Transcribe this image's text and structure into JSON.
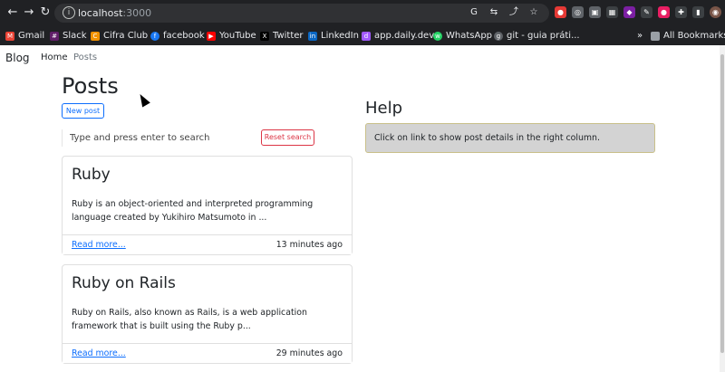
{
  "browser": {
    "url_host": "localhost",
    "url_port": ":3000",
    "bookmarks": [
      {
        "label": "Gmail",
        "icon": "gmail-icon",
        "color": "#ea4335",
        "glyph": "M"
      },
      {
        "label": "Slack",
        "icon": "slack-icon",
        "color": "#611f69",
        "glyph": "#"
      },
      {
        "label": "Cifra Club",
        "icon": "cifra-club-icon",
        "color": "#f29200",
        "glyph": "C"
      },
      {
        "label": "facebook",
        "icon": "facebook-icon",
        "color": "#1877f2",
        "glyph": "f"
      },
      {
        "label": "YouTube",
        "icon": "youtube-icon",
        "color": "#ff0000",
        "glyph": "▶"
      },
      {
        "label": "Twitter",
        "icon": "x-icon",
        "color": "#000000",
        "glyph": "X"
      },
      {
        "label": "LinkedIn",
        "icon": "linkedin-icon",
        "color": "#0a66c2",
        "glyph": "in"
      },
      {
        "label": "app.daily.dev",
        "icon": "daily-dev-icon",
        "color": "#a259ff",
        "glyph": "d"
      },
      {
        "label": "WhatsApp",
        "icon": "whatsapp-icon",
        "color": "#25d366",
        "glyph": "w"
      },
      {
        "label": "git - guia práti...",
        "icon": "globe-icon",
        "color": "#5f6368",
        "glyph": "g"
      }
    ],
    "more_label": "»",
    "all_bookmarks": "All Bookmarks"
  },
  "navbar": {
    "brand": "Blog",
    "home": "Home",
    "posts": "Posts"
  },
  "main": {
    "title": "Posts",
    "new_post_label": "New post",
    "search_placeholder": "Type and press enter to search",
    "reset_label": "Reset search",
    "posts": [
      {
        "title": "Ruby",
        "excerpt": "Ruby is an object-oriented and interpreted programming language created by Yukihiro Matsumoto in ...",
        "read_more": "Read more...",
        "time": "13 minutes ago"
      },
      {
        "title": "Ruby on Rails",
        "excerpt": "Ruby on Rails, also known as Rails, is a web application framework that is built using the Ruby p...",
        "read_more": "Read more...",
        "time": "29 minutes ago"
      }
    ]
  },
  "help": {
    "title": "Help",
    "message": "Click on link to show post details in the right column."
  },
  "colors": {
    "primary": "#0d6efd",
    "danger": "#dc3545",
    "help_bg": "#d3d3d3"
  }
}
